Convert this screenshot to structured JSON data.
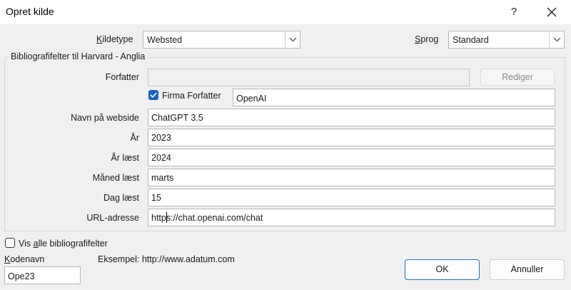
{
  "window": {
    "title": "Opret kilde",
    "help_label": "?"
  },
  "source_type": {
    "label_prefix": "",
    "label_accel": "K",
    "label_rest": "ildetype",
    "value": "Websted"
  },
  "language": {
    "label_accel": "S",
    "label_rest": "prog",
    "value": "Standard"
  },
  "group_title": "Bibliografifelter til Harvard - Anglia",
  "author": {
    "label": "Forfatter",
    "value": "",
    "edit_label": "Rediger"
  },
  "corporate_author": {
    "label": "Firma Forfatter",
    "checked": true,
    "value": "OpenAI"
  },
  "fields": [
    {
      "label": "Navn på webside",
      "value": "ChatGPT 3.5"
    },
    {
      "label": "År",
      "value": "2023"
    },
    {
      "label": "År læst",
      "value": "2024"
    },
    {
      "label": "Måned læst",
      "value": "marts"
    },
    {
      "label": "Dag læst",
      "value": "15"
    },
    {
      "label": "URL-adresse",
      "value": "https://chat.openai.com/chat"
    }
  ],
  "show_all": {
    "label_prefix": "Vis ",
    "label_accel": "a",
    "label_rest": "lle bibliografifelter",
    "checked": false
  },
  "tag": {
    "label_accel": "K",
    "label_rest": "odenavn",
    "value": "Ope23"
  },
  "example_text": "Eksempel: http://www.adatum.com",
  "buttons": {
    "ok": "OK",
    "cancel": "Annuller"
  },
  "colors": {
    "accent": "#1565c0",
    "primary_border": "#1f6fc2"
  }
}
